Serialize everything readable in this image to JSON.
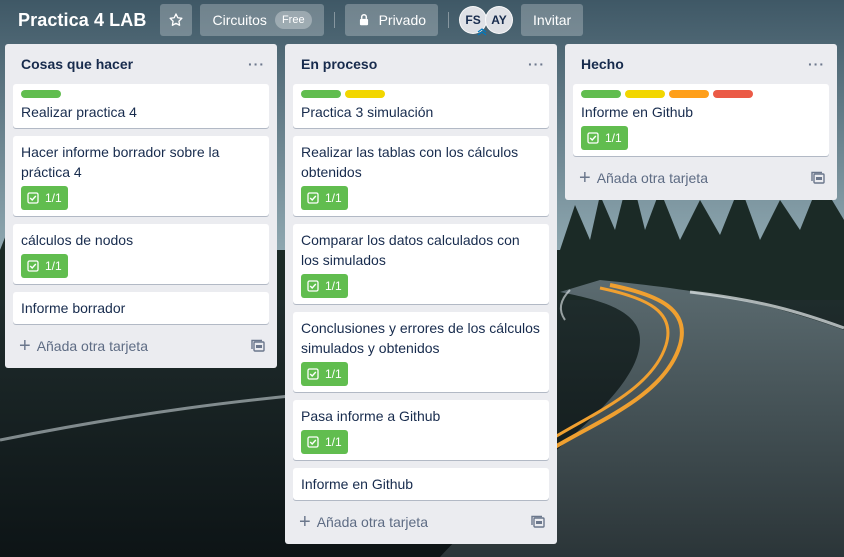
{
  "board": {
    "title": "Practica 4 LAB",
    "team_label": "Circuitos",
    "plan_badge": "Free",
    "visibility_label": "Privado",
    "members": [
      "FS",
      "AY"
    ],
    "invite_label": "Invitar"
  },
  "colors": {
    "green": "#61bd4f",
    "yellow": "#f2d600",
    "orange": "#ff9f1a",
    "red": "#eb5a46"
  },
  "lists": [
    {
      "title": "Cosas que hacer",
      "add_label": "Añada otra tarjeta",
      "cards": [
        {
          "title": "Realizar practica 4",
          "labels": [
            "green"
          ],
          "checklist": ""
        },
        {
          "title": "Hacer informe borrador sobre la práctica 4",
          "labels": [],
          "checklist": "1/1"
        },
        {
          "title": "cálculos de nodos",
          "labels": [],
          "checklist": "1/1"
        },
        {
          "title": "Informe borrador",
          "labels": [],
          "checklist": ""
        }
      ]
    },
    {
      "title": "En proceso",
      "add_label": "Añada otra tarjeta",
      "cards": [
        {
          "title": "Practica 3 simulación",
          "labels": [
            "green",
            "yellow"
          ],
          "checklist": ""
        },
        {
          "title": "Realizar las tablas con los cálculos obtenidos",
          "labels": [],
          "checklist": "1/1"
        },
        {
          "title": "Comparar los datos calculados con los simulados",
          "labels": [],
          "checklist": "1/1"
        },
        {
          "title": "Conclusiones y errores de los cálculos simulados y obtenidos",
          "labels": [],
          "checklist": "1/1"
        },
        {
          "title": "Pasa informe a Github",
          "labels": [],
          "checklist": "1/1"
        },
        {
          "title": "Informe en Github",
          "labels": [],
          "checklist": ""
        }
      ]
    },
    {
      "title": "Hecho",
      "add_label": "Añada otra tarjeta",
      "cards": [
        {
          "title": "Informe en Github",
          "labels": [
            "green",
            "yellow",
            "orange",
            "red"
          ],
          "checklist": "1/1"
        }
      ]
    }
  ]
}
